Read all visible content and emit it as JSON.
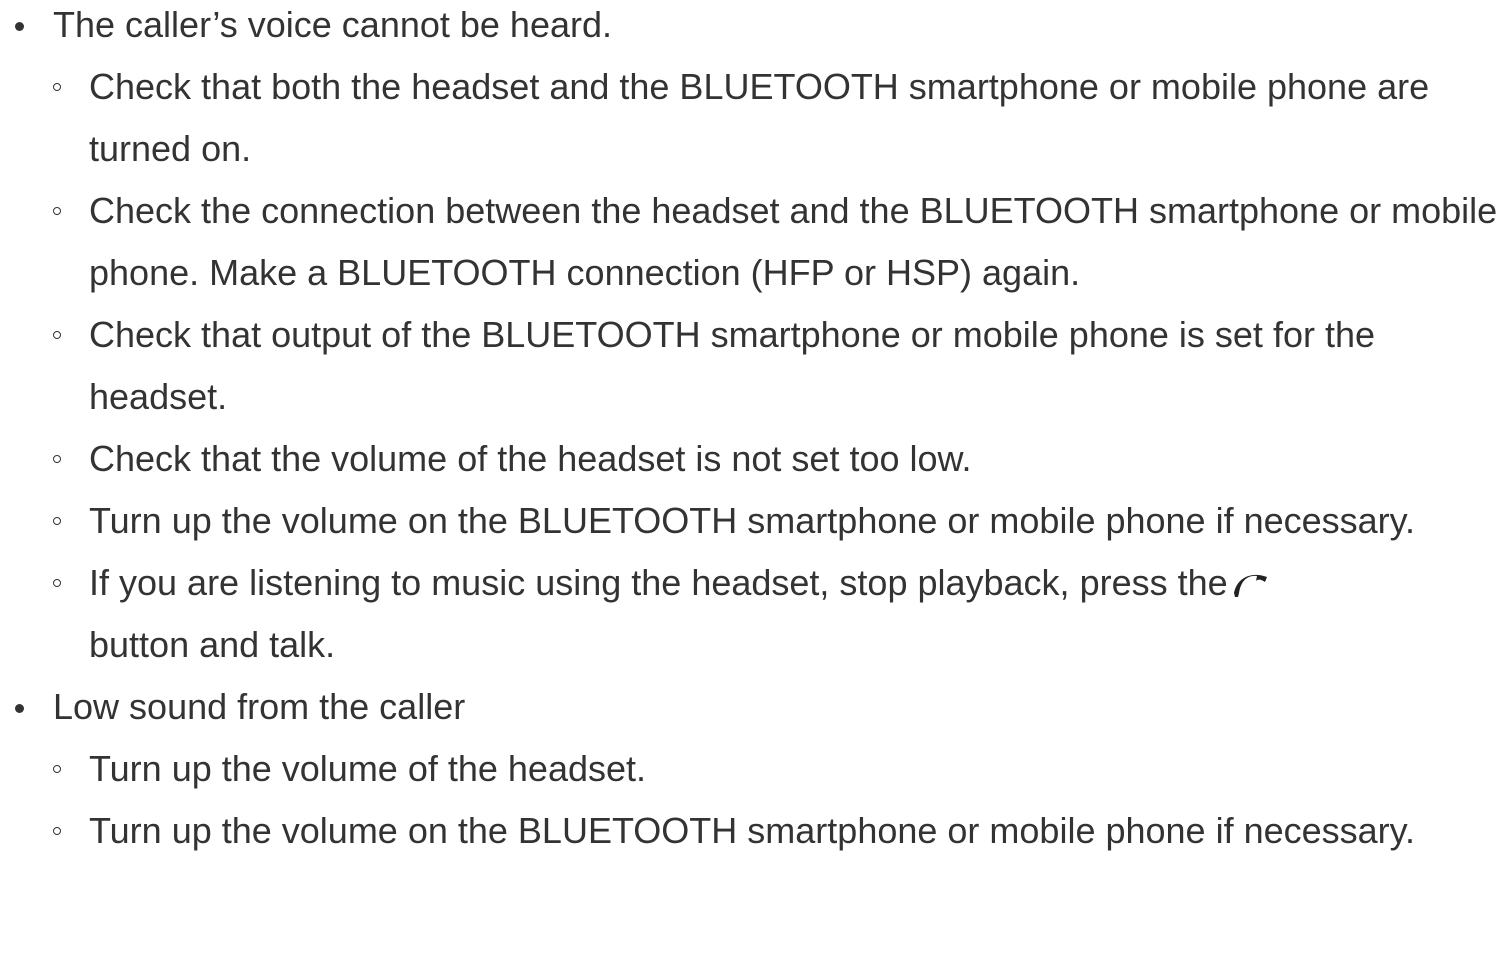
{
  "sections": [
    {
      "title": "The caller’s voice cannot be heard.",
      "items": [
        "Check that both the headset and the BLUETOOTH smartphone or mobile phone are turned on.",
        "Check the connection between the headset and the BLUETOOTH smartphone or mobile phone. Make a BLUETOOTH connection (HFP or HSP) again.",
        "Check that output of the BLUETOOTH smartphone or mobile phone is set for the headset.",
        "Check that the volume of the headset is not set too low.",
        "Turn up the volume on the BLUETOOTH smartphone or mobile phone if necessary."
      ],
      "icon_item": {
        "before": "If you are listening to music using the headset, stop playback, press the",
        "icon": "call-button-icon",
        "after": "button and talk."
      }
    },
    {
      "title": "Low sound from the caller",
      "items": [
        "Turn up the volume of the headset.",
        "Turn up the volume on the BLUETOOTH smartphone or mobile phone if necessary."
      ]
    }
  ],
  "colors": {
    "text": "#333333",
    "background": "#ffffff"
  }
}
